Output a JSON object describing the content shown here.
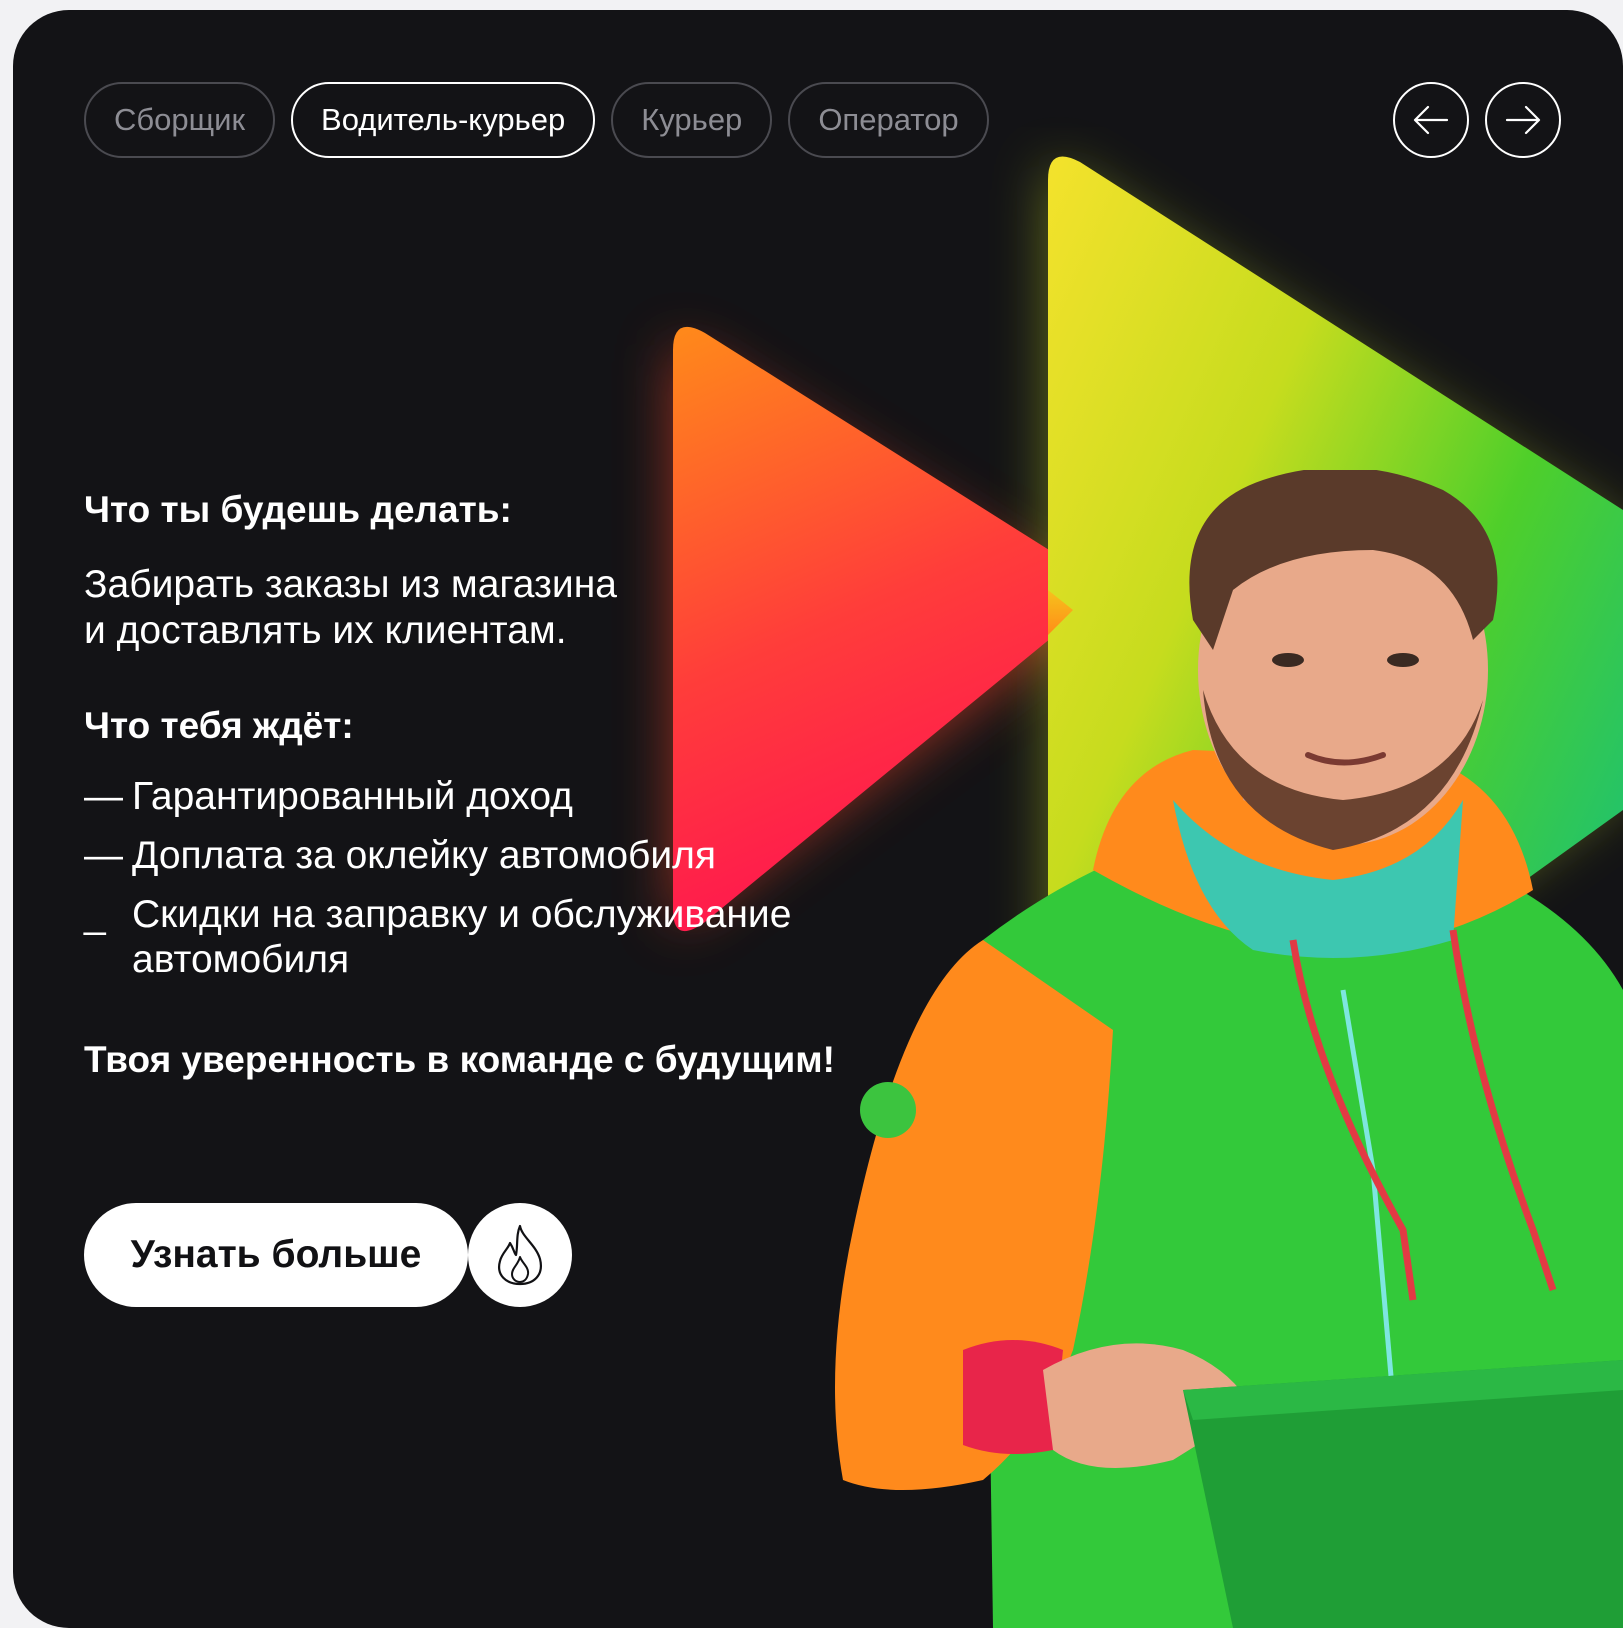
{
  "tabs": [
    {
      "label": "Сборщик",
      "active": false
    },
    {
      "label": "Водитель-курьер",
      "active": true
    },
    {
      "label": "Курьер",
      "active": false
    },
    {
      "label": "Оператор",
      "active": false
    }
  ],
  "nav": {
    "prev_icon": "arrow-left-icon",
    "next_icon": "arrow-right-icon"
  },
  "content": {
    "heading_tasks": "Что ты будешь делать:",
    "tasks_line1": "Забирать заказы из магазина",
    "tasks_line2": "и доставлять их клиентам.",
    "heading_benefits": "Что тебя ждёт:",
    "benefits": [
      {
        "dash": "—",
        "text": "Гарантированный доход"
      },
      {
        "dash": "—",
        "text": "Доплата за оклейку автомобиля"
      },
      {
        "dash": "_",
        "text": "Скидки на заправку и обслуживание автомобиля"
      }
    ],
    "tagline": "Твоя уверенность в команде с будущим!"
  },
  "cta": {
    "label": "Узнать больше",
    "icon": "flame-icon"
  },
  "colors": {
    "background": "#131316",
    "arrow_left_gradient": [
      "#ff7a1a",
      "#ff1f4b"
    ],
    "arrow_right_gradient": [
      "#f2e02a",
      "#1fc832"
    ],
    "hoodie_green": "#33c93a",
    "hoodie_orange": "#ff8a1c"
  }
}
